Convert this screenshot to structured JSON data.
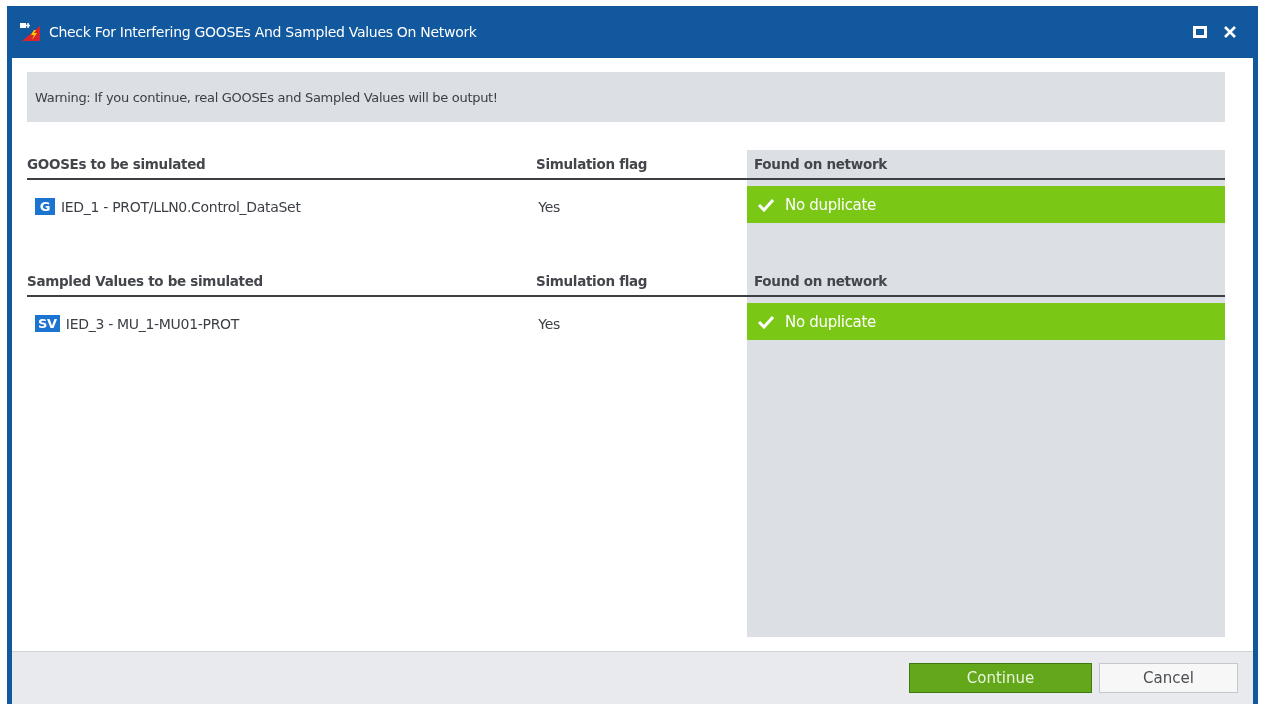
{
  "window": {
    "title": "Check For Interfering GOOSEs And Sampled Values On Network"
  },
  "warning": "Warning: If you continue, real GOOSEs and Sampled Values will be output!",
  "sections": [
    {
      "columns": [
        "GOOSEs to be simulated",
        "Simulation flag",
        "Found on network"
      ],
      "rows": [
        {
          "badge": "G",
          "name": "IED_1 - PROT/LLN0.Control_DataSet",
          "flag": "Yes",
          "duplicate": false,
          "result": "No duplicate"
        }
      ]
    },
    {
      "columns": [
        "Sampled Values to be simulated",
        "Simulation flag",
        "Found on network"
      ],
      "rows": [
        {
          "badge": "SV",
          "name": "IED_3 - MU_1-MU01-PROT",
          "flag": "Yes",
          "duplicate": false,
          "result": "No duplicate"
        }
      ]
    }
  ],
  "buttons": [
    {
      "label": "Continue",
      "primary": true
    },
    {
      "label": "Cancel",
      "primary": false
    }
  ]
}
